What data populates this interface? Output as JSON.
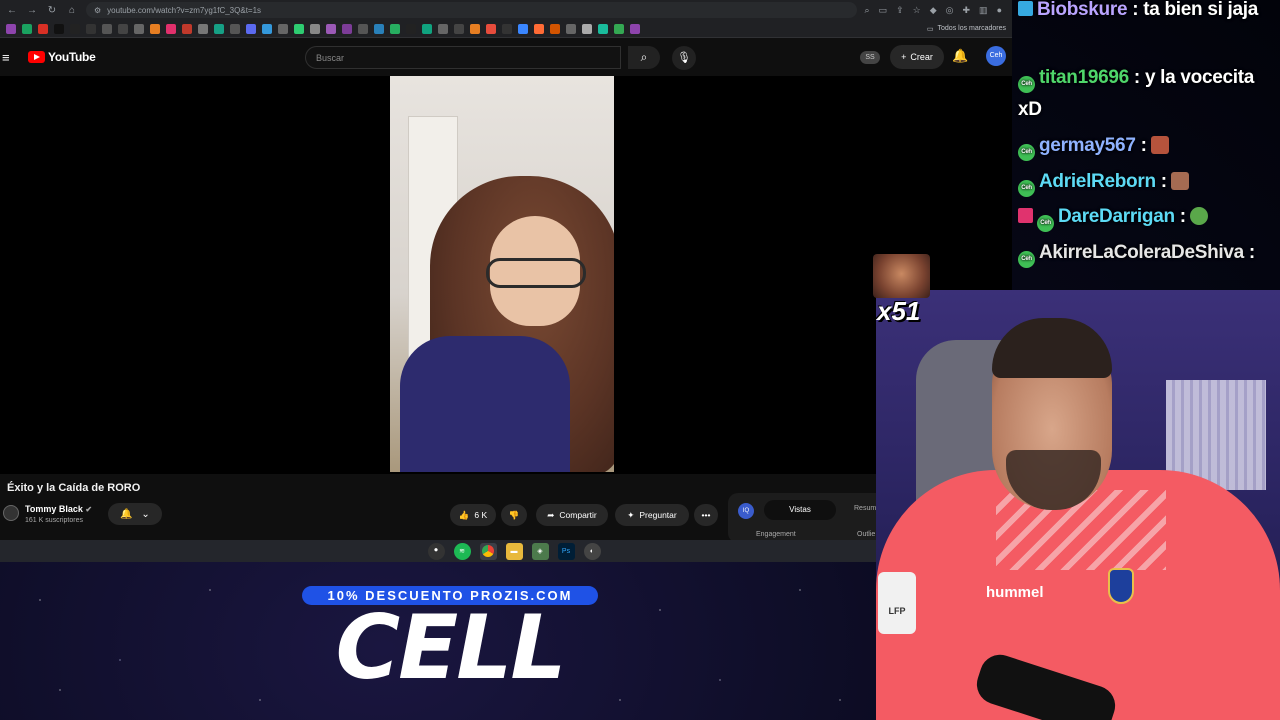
{
  "browser": {
    "url": "youtube.com/watch?v=zm7yg1fC_3Q&t=1s",
    "all_bookmarks": "Todos los marcadores"
  },
  "youtube": {
    "logo_text": "YouTube",
    "search_placeholder": "Buscar",
    "ss_label": "SS",
    "create_label": "Crear",
    "avatar_label": "Ceh"
  },
  "video": {
    "title": "Éxito y la Caída de RORO",
    "channel": "Tommy Black",
    "subscribers": "161 K suscriptores",
    "likes": "6 K",
    "share_label": "Compartir",
    "ask_label": "Preguntar",
    "more_label": "•••"
  },
  "analytics": {
    "icon_label": "IQ",
    "tab_active": "Vistas",
    "tab_other": "Resum",
    "label_engagement": "Engagement",
    "label_outlier": "Outlie"
  },
  "chat": {
    "messages": [
      {
        "user": "Biobskure",
        "text": " : ta bien si jaja",
        "color": "#b9a4ff"
      },
      {
        "user": "titan19696",
        "text": " : y la vocecita xD",
        "color": "#4fd66b"
      },
      {
        "user": "germay567",
        "text": " :",
        "color": "#8fb2ff"
      },
      {
        "user": "AdrielReborn",
        "text": " :",
        "color": "#5ddaf5"
      },
      {
        "user": "DareDarrigan",
        "text": " :",
        "color": "#5ddaf5"
      },
      {
        "user": "AkirreLaColeraDeShiva",
        "text": " :",
        "color": "#e6e6e6"
      }
    ],
    "badge_label": "Ceh",
    "emote_counter": "x51"
  },
  "stream": {
    "shirt_brand": "hummel",
    "patch_text": "LFP",
    "promo_tag": "10% DESCUENTO PROZIS.COM",
    "promo_word": "CELL"
  },
  "colors": {
    "youtube_red": "#ff0000",
    "promo_blue": "#1f52e6",
    "shirt_coral": "#f45b63"
  }
}
